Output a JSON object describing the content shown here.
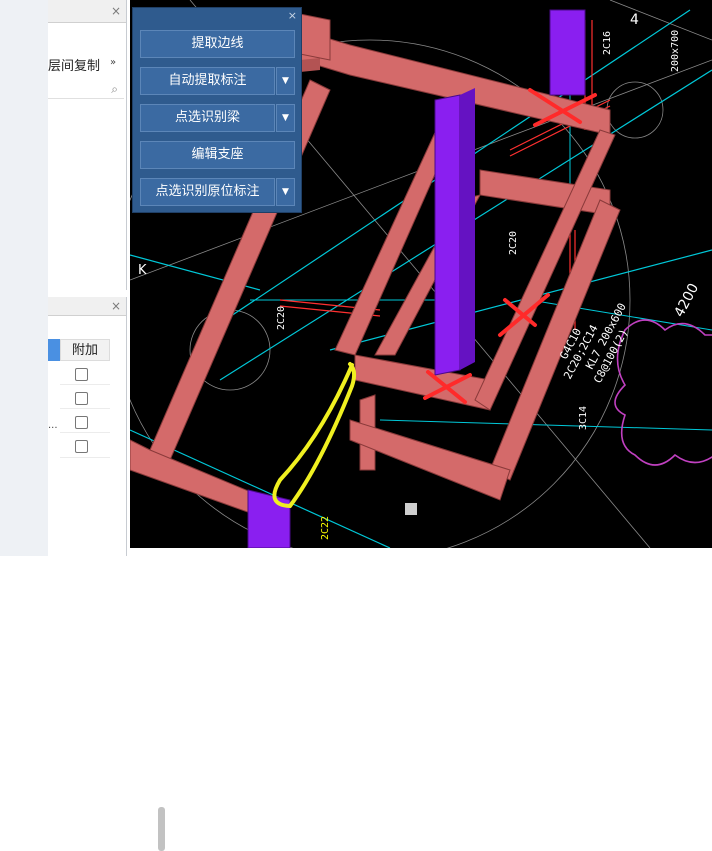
{
  "left_panel_top": {
    "close_glyph": "×",
    "menu_label": "层间复制",
    "more_glyph": "»",
    "search_glyph": "⌕"
  },
  "left_panel_bottom": {
    "close_glyph": "×",
    "column_header": "附加",
    "ellipsis": "...",
    "checkbox_count": 4
  },
  "tool_panel": {
    "close_glyph": "×",
    "buttons": [
      {
        "label": "提取边线",
        "has_dropdown": false
      },
      {
        "label": "自动提取标注",
        "has_dropdown": true
      },
      {
        "label": "点选识别梁",
        "has_dropdown": true
      },
      {
        "label": "编辑支座",
        "has_dropdown": false
      },
      {
        "label": "点选识别原位标注",
        "has_dropdown": true
      }
    ],
    "dropdown_glyph": "▼"
  },
  "cad_view": {
    "axis_label_top": "4",
    "axis_label_left": "K",
    "dimension": "4200",
    "annotations": [
      "KL7 200x600",
      "C8@100(2)",
      "2C20;2C14",
      "G4C10",
      "3C14",
      "2C20",
      "2C22",
      "2C16",
      "200x700",
      "2C20"
    ],
    "colors": {
      "beam": "#d46a6a",
      "column": "#8a1ff0",
      "background": "#000000",
      "cyan_lines": "#00c8d8",
      "red_lines": "#ff3030",
      "yellow_marks": "#f0f020",
      "magenta_cloud": "#c040c0",
      "mark_x": "#ff2a2a",
      "annotation_yellow": "#ffff00"
    }
  }
}
